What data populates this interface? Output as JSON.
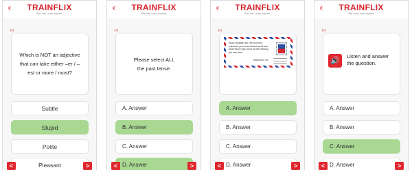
{
  "brand": {
    "logo": "TRAINFLIX",
    "tagline": "Bite Size Learn Anytime",
    "accent": "#e0262e",
    "selected_color": "#a8d891"
  },
  "icons": {
    "back": "chevron-left-icon",
    "prev": "arrow-left-icon",
    "next": "arrow-right-icon",
    "speaker": "speaker-icon"
  },
  "screens": [
    {
      "back": "‹",
      "counter": "1/4",
      "question": "Which is NOT an adjective that can take either –er / –est or more / most?",
      "options": [
        "Subtle",
        "Stupid",
        "Polite",
        "Pleasant"
      ],
      "selected": [
        "Stupid"
      ],
      "prev": "<",
      "next": ">"
    },
    {
      "back": "‹",
      "counter": "1/4",
      "question": "Please select ALL the past tense.",
      "options": [
        "A. Answer",
        "B. Answer",
        "C. Answer",
        "D. Answer"
      ],
      "selected": [
        "B. Answer",
        "D. Answer"
      ],
      "prev": "<",
      "next": ">"
    },
    {
      "back": "‹",
      "counter": "1/4",
      "postcard_text": "What a fantastic trip. We found the restaurant you recommended and it was what! Wow! Hope you're all well! Wishing you were here.",
      "postcard_signature": "Maria and Tim",
      "options": [
        "A. Answer",
        "B. Answer",
        "C. Answer",
        "D. Answer"
      ],
      "selected": [
        "A. Answer"
      ],
      "prev": "<",
      "next": ">"
    },
    {
      "back": "‹",
      "counter": "1/4",
      "question": "Listen and answer the question.",
      "speaker_glyph": "🔊",
      "options": [
        "A. Answer",
        "B. Answer",
        "C. Answer",
        "D. Answer"
      ],
      "selected": [
        "C. Answer"
      ],
      "prev": "<",
      "next": ">"
    }
  ]
}
